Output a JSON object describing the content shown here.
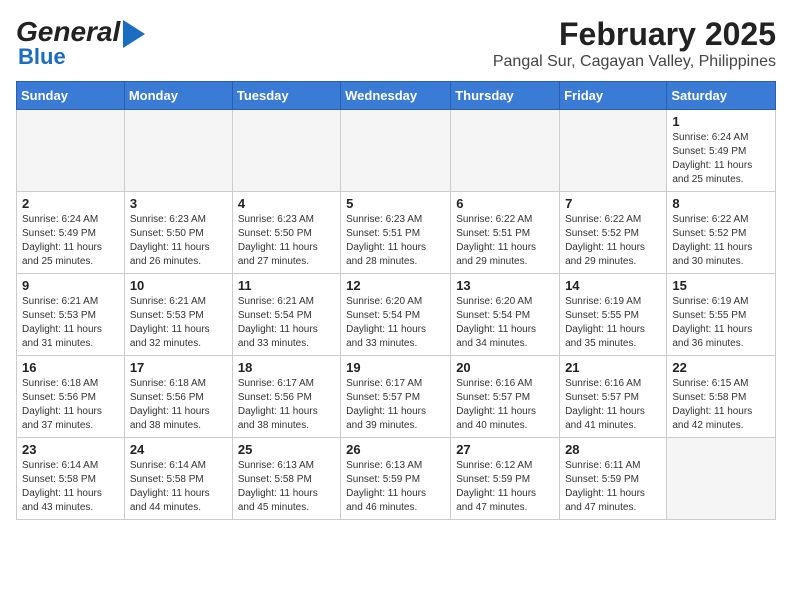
{
  "header": {
    "logo_general": "General",
    "logo_blue": "Blue",
    "title": "February 2025",
    "subtitle": "Pangal Sur, Cagayan Valley, Philippines"
  },
  "calendar": {
    "days_of_week": [
      "Sunday",
      "Monday",
      "Tuesday",
      "Wednesday",
      "Thursday",
      "Friday",
      "Saturday"
    ],
    "weeks": [
      [
        {
          "day": "",
          "info": ""
        },
        {
          "day": "",
          "info": ""
        },
        {
          "day": "",
          "info": ""
        },
        {
          "day": "",
          "info": ""
        },
        {
          "day": "",
          "info": ""
        },
        {
          "day": "",
          "info": ""
        },
        {
          "day": "1",
          "info": "Sunrise: 6:24 AM\nSunset: 5:49 PM\nDaylight: 11 hours and 25 minutes."
        }
      ],
      [
        {
          "day": "2",
          "info": "Sunrise: 6:24 AM\nSunset: 5:49 PM\nDaylight: 11 hours and 25 minutes."
        },
        {
          "day": "3",
          "info": "Sunrise: 6:23 AM\nSunset: 5:50 PM\nDaylight: 11 hours and 26 minutes."
        },
        {
          "day": "4",
          "info": "Sunrise: 6:23 AM\nSunset: 5:50 PM\nDaylight: 11 hours and 27 minutes."
        },
        {
          "day": "5",
          "info": "Sunrise: 6:23 AM\nSunset: 5:51 PM\nDaylight: 11 hours and 28 minutes."
        },
        {
          "day": "6",
          "info": "Sunrise: 6:22 AM\nSunset: 5:51 PM\nDaylight: 11 hours and 29 minutes."
        },
        {
          "day": "7",
          "info": "Sunrise: 6:22 AM\nSunset: 5:52 PM\nDaylight: 11 hours and 29 minutes."
        },
        {
          "day": "8",
          "info": "Sunrise: 6:22 AM\nSunset: 5:52 PM\nDaylight: 11 hours and 30 minutes."
        }
      ],
      [
        {
          "day": "9",
          "info": "Sunrise: 6:21 AM\nSunset: 5:53 PM\nDaylight: 11 hours and 31 minutes."
        },
        {
          "day": "10",
          "info": "Sunrise: 6:21 AM\nSunset: 5:53 PM\nDaylight: 11 hours and 32 minutes."
        },
        {
          "day": "11",
          "info": "Sunrise: 6:21 AM\nSunset: 5:54 PM\nDaylight: 11 hours and 33 minutes."
        },
        {
          "day": "12",
          "info": "Sunrise: 6:20 AM\nSunset: 5:54 PM\nDaylight: 11 hours and 33 minutes."
        },
        {
          "day": "13",
          "info": "Sunrise: 6:20 AM\nSunset: 5:54 PM\nDaylight: 11 hours and 34 minutes."
        },
        {
          "day": "14",
          "info": "Sunrise: 6:19 AM\nSunset: 5:55 PM\nDaylight: 11 hours and 35 minutes."
        },
        {
          "day": "15",
          "info": "Sunrise: 6:19 AM\nSunset: 5:55 PM\nDaylight: 11 hours and 36 minutes."
        }
      ],
      [
        {
          "day": "16",
          "info": "Sunrise: 6:18 AM\nSunset: 5:56 PM\nDaylight: 11 hours and 37 minutes."
        },
        {
          "day": "17",
          "info": "Sunrise: 6:18 AM\nSunset: 5:56 PM\nDaylight: 11 hours and 38 minutes."
        },
        {
          "day": "18",
          "info": "Sunrise: 6:17 AM\nSunset: 5:56 PM\nDaylight: 11 hours and 38 minutes."
        },
        {
          "day": "19",
          "info": "Sunrise: 6:17 AM\nSunset: 5:57 PM\nDaylight: 11 hours and 39 minutes."
        },
        {
          "day": "20",
          "info": "Sunrise: 6:16 AM\nSunset: 5:57 PM\nDaylight: 11 hours and 40 minutes."
        },
        {
          "day": "21",
          "info": "Sunrise: 6:16 AM\nSunset: 5:57 PM\nDaylight: 11 hours and 41 minutes."
        },
        {
          "day": "22",
          "info": "Sunrise: 6:15 AM\nSunset: 5:58 PM\nDaylight: 11 hours and 42 minutes."
        }
      ],
      [
        {
          "day": "23",
          "info": "Sunrise: 6:14 AM\nSunset: 5:58 PM\nDaylight: 11 hours and 43 minutes."
        },
        {
          "day": "24",
          "info": "Sunrise: 6:14 AM\nSunset: 5:58 PM\nDaylight: 11 hours and 44 minutes."
        },
        {
          "day": "25",
          "info": "Sunrise: 6:13 AM\nSunset: 5:58 PM\nDaylight: 11 hours and 45 minutes."
        },
        {
          "day": "26",
          "info": "Sunrise: 6:13 AM\nSunset: 5:59 PM\nDaylight: 11 hours and 46 minutes."
        },
        {
          "day": "27",
          "info": "Sunrise: 6:12 AM\nSunset: 5:59 PM\nDaylight: 11 hours and 47 minutes."
        },
        {
          "day": "28",
          "info": "Sunrise: 6:11 AM\nSunset: 5:59 PM\nDaylight: 11 hours and 47 minutes."
        },
        {
          "day": "",
          "info": ""
        }
      ]
    ]
  }
}
